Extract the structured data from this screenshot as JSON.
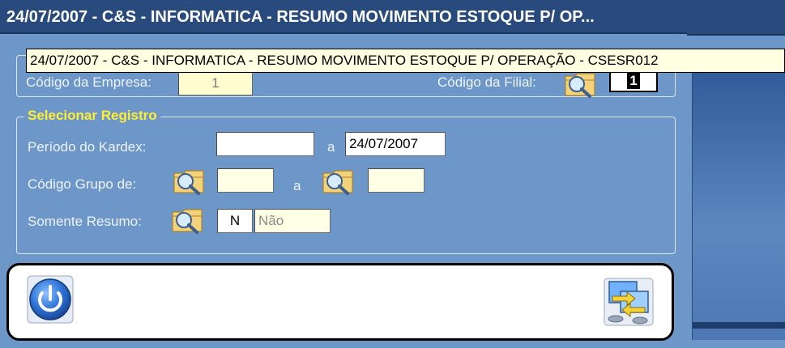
{
  "window": {
    "title": "24/07/2007  -  C&S - INFORMATICA  -  RESUMO MOVIMENTO ESTOQUE P/ OP...",
    "tooltip": "24/07/2007  -  C&S - INFORMATICA  -  RESUMO MOVIMENTO ESTOQUE P/ OPERAÇÃO  -  CSESR012"
  },
  "company": {
    "empresa_label": "Código da Empresa:",
    "empresa_value": "1",
    "filial_label": "Código da Filial:",
    "filial_value": "1"
  },
  "selecionar": {
    "title": "Selecionar Registro",
    "periodo_label": "Período do Kardex:",
    "periodo_from": "",
    "periodo_sep": "a",
    "periodo_to": "24/07/2007",
    "grupo_label": "Código Grupo de:",
    "grupo_from": "",
    "grupo_sep": "a",
    "grupo_to": "",
    "resumo_label": "Somente Resumo:",
    "resumo_code": "N",
    "resumo_desc": "Não"
  },
  "toolbar": {
    "power_icon": "power-icon",
    "transfer_icon": "transfer-icon"
  },
  "colors": {
    "background": "#6d96c9",
    "titlebar": "#294a7d",
    "group_title": "#ffee33"
  }
}
